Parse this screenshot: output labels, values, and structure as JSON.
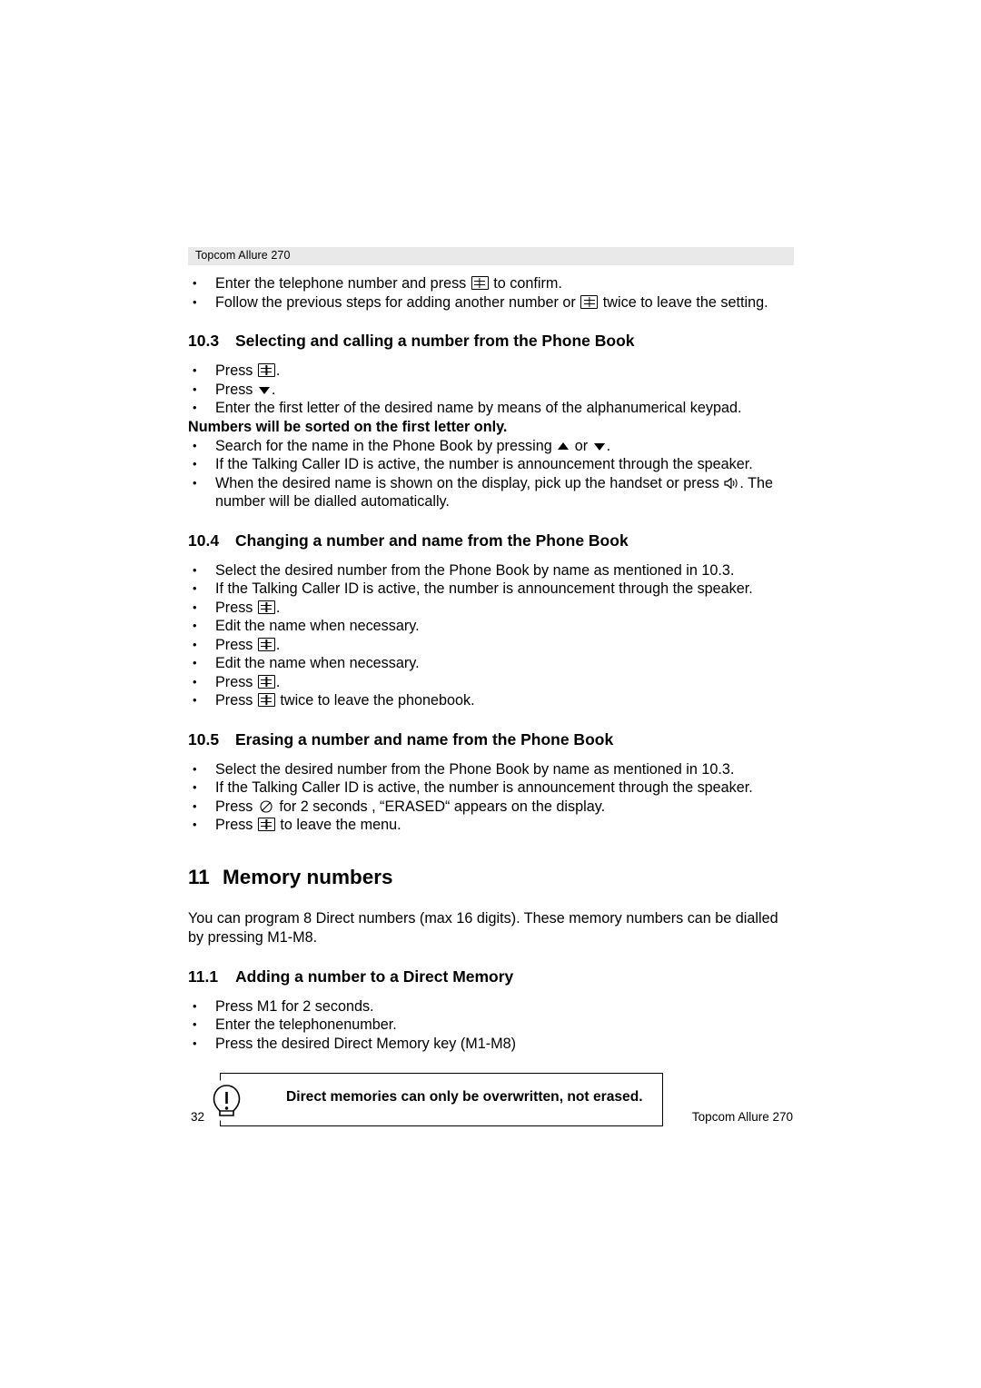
{
  "header": {
    "running_head": "Topcom Allure 270"
  },
  "intro_bullets": [
    {
      "pre": "Enter the telephone number and press ",
      "icon": "phonebook-icon",
      "post": " to confirm."
    },
    {
      "pre": "Follow the previous steps for adding another number or ",
      "icon": "phonebook-icon",
      "post": " twice to leave the setting."
    }
  ],
  "sections": [
    {
      "number": "10.3",
      "title": "Selecting and calling a number from the Phone Book",
      "bullets": [
        {
          "pre": "Press ",
          "icon": "phonebook-icon",
          "post": "."
        },
        {
          "pre": "Press ",
          "icon": "down-arrow-icon",
          "post": "."
        },
        {
          "pre": "Enter the first letter of the desired name by means of the alphanumerical keypad.",
          "icon": "",
          "post": ""
        }
      ],
      "bold_note": "Numbers will be sorted on the first letter only.",
      "bullets2": [
        {
          "pre": "Search for the name in the Phone Book by pressing ",
          "icon": "up-arrow-icon",
          "mid": " or ",
          "icon2": "down-arrow-icon",
          "post": "."
        },
        {
          "pre": "If the Talking Caller ID is active, the number is announcement through the speaker.",
          "icon": "",
          "post": ""
        },
        {
          "pre": "When the desired name is shown on the display, pick up the handset or press ",
          "icon": "speaker-icon",
          "post": ". The number will be dialled automatically."
        }
      ]
    },
    {
      "number": "10.4",
      "title": "Changing a number and name from the Phone Book",
      "bullets": [
        {
          "pre": "Select the desired number from the Phone Book by name as mentioned in 10.3.",
          "icon": "",
          "post": ""
        },
        {
          "pre": "If the Talking Caller ID is active, the number is announcement through the speaker.",
          "icon": "",
          "post": ""
        },
        {
          "pre": "Press ",
          "icon": "phonebook-icon",
          "post": "."
        },
        {
          "pre": "Edit the name when necessary.",
          "icon": "",
          "post": ""
        },
        {
          "pre": "Press ",
          "icon": "phonebook-icon",
          "post": "."
        },
        {
          "pre": "Edit the name when necessary.",
          "icon": "",
          "post": ""
        },
        {
          "pre": "Press ",
          "icon": "phonebook-icon",
          "post": "."
        },
        {
          "pre": "Press ",
          "icon": "phonebook-icon",
          "post": " twice to leave the phonebook."
        }
      ]
    },
    {
      "number": "10.5",
      "title": "Erasing a number and name from the Phone Book",
      "bullets": [
        {
          "pre": "Select the desired number from the Phone Book by name as mentioned in 10.3.",
          "icon": "",
          "post": ""
        },
        {
          "pre": "If the Talking Caller ID is active, the number is announcement through the speaker.",
          "icon": "",
          "post": ""
        },
        {
          "pre": "Press ",
          "icon": "erase-icon",
          "post": " for 2 seconds , “ERASED“ appears on the display."
        },
        {
          "pre": "Press ",
          "icon": "phonebook-icon",
          "post": " to leave the menu."
        }
      ]
    }
  ],
  "chapter": {
    "number": "11",
    "title": "Memory numbers",
    "paragraph": "You can program 8 Direct numbers (max 16 digits). These memory numbers can be dialled by pressing M1-M8.",
    "subsection": {
      "number": "11.1",
      "title": "Adding a number to a Direct Memory",
      "bullets": [
        "Press M1 for 2 seconds.",
        "Enter the telephonenumber.",
        "Press the desired Direct Memory key (M1-M8)"
      ]
    },
    "note": "Direct memories can only be overwritten, not erased."
  },
  "footer": {
    "page_number": "32",
    "right_text": "Topcom Allure  270"
  }
}
